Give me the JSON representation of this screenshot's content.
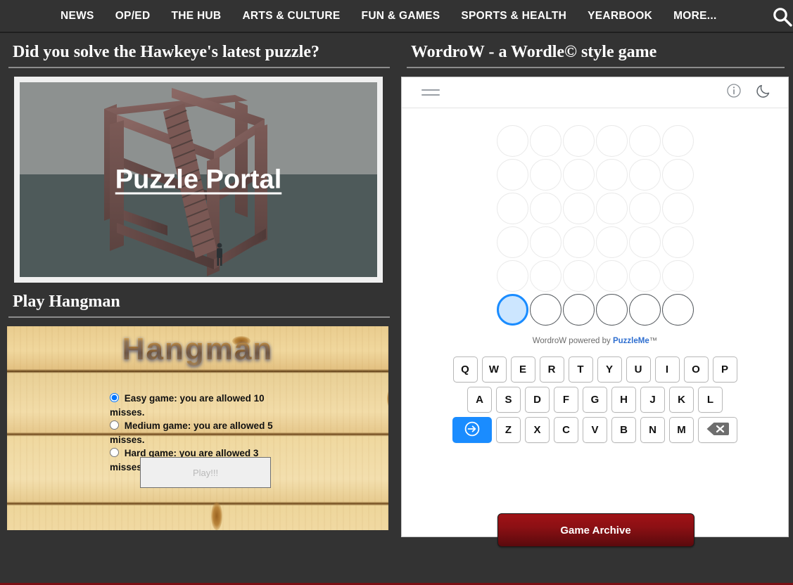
{
  "nav": {
    "items": [
      {
        "label": "NEWS"
      },
      {
        "label": "OP/ED"
      },
      {
        "label": "THE HUB"
      },
      {
        "label": "ARTS & CULTURE"
      },
      {
        "label": "FUN & GAMES"
      },
      {
        "label": "SPORTS & HEALTH"
      },
      {
        "label": "YEARBOOK"
      },
      {
        "label": "MORE..."
      }
    ],
    "search_icon": "search-icon"
  },
  "puzzle_section": {
    "title": "Did you solve the Hawkeye's latest puzzle?",
    "image_caption": "Puzzle Portal"
  },
  "hangman_section": {
    "title": "Play Hangman",
    "logo_text": "Hangman",
    "options": [
      {
        "label": "Easy game: you are allowed 10 misses.",
        "selected": true
      },
      {
        "label": "Medium game: you are allowed 5 misses.",
        "selected": false
      },
      {
        "label": "Hard game: you are allowed 3 misses.",
        "selected": false
      }
    ],
    "play_label": "Play!!!"
  },
  "wordrow_section": {
    "title": "WordroW - a Wordle© style game",
    "toolbar": {
      "menu_icon": "hamburger-menu-icon",
      "info_icon": "info-icon",
      "dark_mode_icon": "moon-icon"
    },
    "board": {
      "rows": 6,
      "cols": 6,
      "active_row_index": 5,
      "selected_cell_index": 0,
      "active_border_color": "#1a8cff",
      "active_fill_color": "#cce6ff",
      "idle_border_color": "#eaeaea"
    },
    "credit": {
      "prefix": "WordroW powered by ",
      "brand": "PuzzleMe",
      "suffix": "™",
      "brand_color": "#2f6fd0"
    },
    "keyboard": {
      "row1": [
        "Q",
        "W",
        "E",
        "R",
        "T",
        "Y",
        "U",
        "I",
        "O",
        "P"
      ],
      "row2": [
        "A",
        "S",
        "D",
        "F",
        "G",
        "H",
        "J",
        "K",
        "L"
      ],
      "row3": [
        "Z",
        "X",
        "C",
        "V",
        "B",
        "N",
        "M"
      ],
      "enter_icon": "enter-arrow-icon",
      "backspace_icon": "backspace-icon",
      "enter_color": "#1a8cff"
    }
  },
  "archive": {
    "label": "Game Archive",
    "color": "#8c1014"
  }
}
